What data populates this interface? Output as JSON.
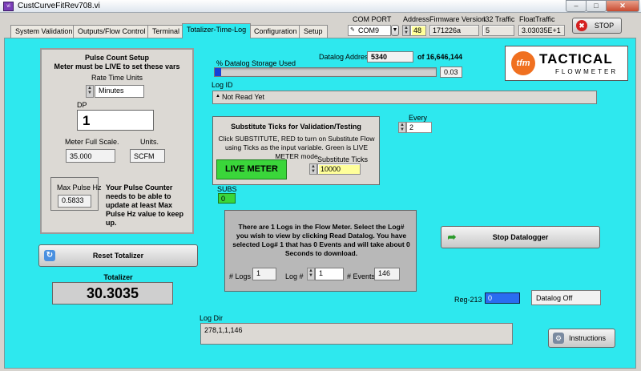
{
  "window": {
    "title": "CustCurveFitRev708.vi",
    "app_icon": "vi"
  },
  "header": {
    "com_port_label": "COM PORT",
    "com_port_value": "COM9",
    "address_label": "Address",
    "address_value": "48",
    "firmware_label": "Firmware Version",
    "firmware_value": "171226a",
    "i32_label": "I32 Traffic",
    "i32_value": "5",
    "float_label": "FloatTraffic",
    "float_value": "3.03035E+1",
    "stop_label": "STOP"
  },
  "tabs": [
    {
      "label": "System Validation"
    },
    {
      "label": "Outputs/Flow Control"
    },
    {
      "label": "Terminal"
    },
    {
      "label": "Totalizer-Time-Log"
    },
    {
      "label": "Configuration"
    },
    {
      "label": "Setup"
    }
  ],
  "pulse": {
    "title_line1": "Pulse Count Setup",
    "title_line2": "Meter must be LIVE to set these vars",
    "rate_time_units_label": "Rate Time Units",
    "rate_time_units_value": "Minutes",
    "dp_label": "DP",
    "dp_value": "1",
    "full_scale_label": "Meter Full Scale.",
    "full_scale_value": "35.000",
    "units_label": "Units.",
    "units_value": "SCFM",
    "max_pulse_label": "Max Pulse Hz",
    "max_pulse_value": "0.5833",
    "note": "Your Pulse Counter needs to be able to update at least Max Pulse Hz  value to keep up."
  },
  "reset_totalizer_label": "Reset Totalizer",
  "totalizer": {
    "label": "Totalizer",
    "value": "30.3035"
  },
  "datalog": {
    "address_label": "Datalog Address",
    "address_value": "5340",
    "of_label": "of 16,646,144",
    "storage_label": "% Datalog Storage Used",
    "storage_value": "0.03",
    "storage_fraction": 0.03
  },
  "logo": {
    "mark": "tfm",
    "name": "TACTICAL",
    "sub": "FLOWMETER"
  },
  "log_id": {
    "label": "Log ID",
    "value": "Not Read Yet"
  },
  "subst": {
    "title": "Substitute Ticks for Validation/Testing",
    "desc": "Click SUBSTITUTE, RED to turn on Substitute Flow using Ticks as the input variable. Green is  LIVE METER mode",
    "live_label": "LIVE METER",
    "ticks_label": "Substitute Ticks",
    "ticks_value": "10000"
  },
  "every": {
    "label": "Every",
    "value": "2"
  },
  "subs": {
    "label": "SUBS",
    "value": "0"
  },
  "logs_info": {
    "message": "There are 1 Logs in the Flow Meter. Select the Log# you wish to view by clicking Read Datalog. You have selected Log# 1 that has 0 Events and will take about 0 Seconds to download.",
    "num_logs_label": "# Logs",
    "num_logs_value": "1",
    "log_num_label": "Log #",
    "log_num_value": "1",
    "events_label": "# Events",
    "events_value": "146"
  },
  "stop_datalogger_label": "Stop Datalogger",
  "reg213": {
    "label": "Reg-213",
    "value": "0"
  },
  "datalog_status": "Datalog Off",
  "log_dir": {
    "label": "Log Dir",
    "value": "278,1,1,146"
  },
  "instructions_label": "Instructions",
  "colors": {
    "panel_bg": "#2ee8ee",
    "live_green": "#3ad63a",
    "bar_blue": "#1440d8",
    "reg_blue": "#2a6cf0"
  }
}
